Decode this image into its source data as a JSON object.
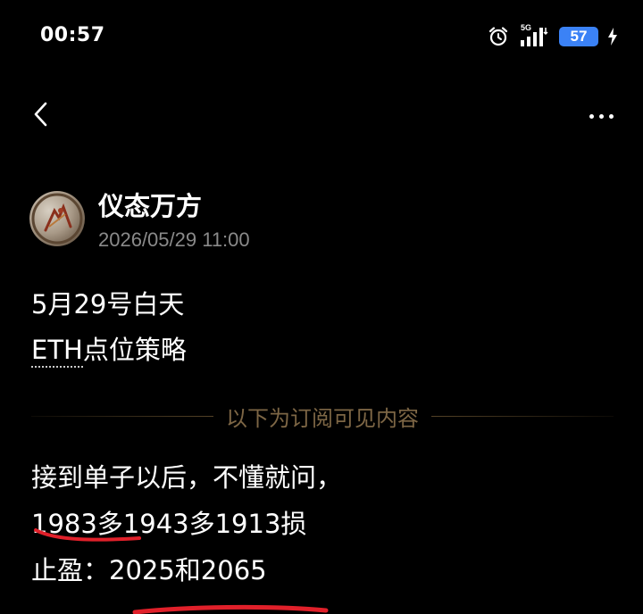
{
  "status_bar": {
    "time": "00:57",
    "network": "5G",
    "battery": "57"
  },
  "icons": {
    "alarm": "alarm-icon",
    "signal": "signal-icon",
    "charging": "charging-icon",
    "back": "chevron-left-icon",
    "more": "more-dots-icon"
  },
  "author": {
    "name": "仪态万方",
    "timestamp": "2026/05/29 11:00"
  },
  "post": {
    "line1": "5月29号白天",
    "line2_eth": "ETH",
    "line2_rest": "点位策略",
    "divider": "以下为订阅可见内容",
    "line3": "接到单子以后，不懂就问，",
    "line4": "1983多1943多1913损",
    "line5": "止盈：2025和2065"
  },
  "colors": {
    "background": "#000000",
    "text": "#ffffff",
    "muted": "#8a8a8a",
    "divider_text": "#7d6645",
    "battery_badge": "#3b82f6",
    "annotation_red": "#e0202a"
  }
}
